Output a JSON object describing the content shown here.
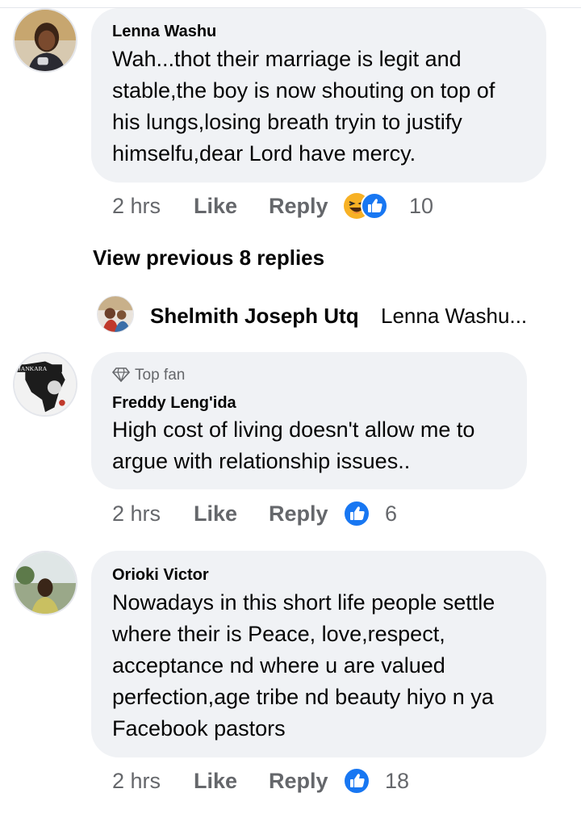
{
  "comments": [
    {
      "author": "Lenna Washu",
      "lines": [
        "Wah...thot their marriage is legit and",
        "stable,the boy is now shouting on top of",
        "his lungs,losing breath tryin to justify",
        "himselfu,dear Lord have mercy."
      ],
      "time": "2 hrs",
      "like_label": "Like",
      "reply_label": "Reply",
      "reactions": [
        "haha-icon",
        "like-icon"
      ],
      "reaction_count": "10"
    },
    {
      "badge": "Top fan",
      "author": "Freddy Leng'ida",
      "lines": [
        "High cost of living doesn't allow me to",
        "argue with relationship issues.."
      ],
      "time": "2 hrs",
      "like_label": "Like",
      "reply_label": "Reply",
      "reactions": [
        "like-icon"
      ],
      "reaction_count": "6"
    },
    {
      "author": "Orioki Victor",
      "lines": [
        "Nowadays in this short life people settle",
        "where their is Peace, love,respect,",
        "acceptance nd where u are valued",
        "perfection,age tribe nd beauty hiyo n ya",
        "Facebook pastors"
      ],
      "time": "2 hrs",
      "like_label": "Like",
      "reply_label": "Reply",
      "reactions": [
        "like-icon"
      ],
      "reaction_count": "18"
    }
  ],
  "view_previous": "View previous 8 replies",
  "collapsed_reply": {
    "author": "Shelmith Joseph Utq",
    "preview": "Lenna Washu..."
  },
  "colors": {
    "bubble": "#f0f2f5",
    "meta": "#65676b",
    "like_blue": "#1877f2",
    "haha_yellow": "#f7b125"
  }
}
